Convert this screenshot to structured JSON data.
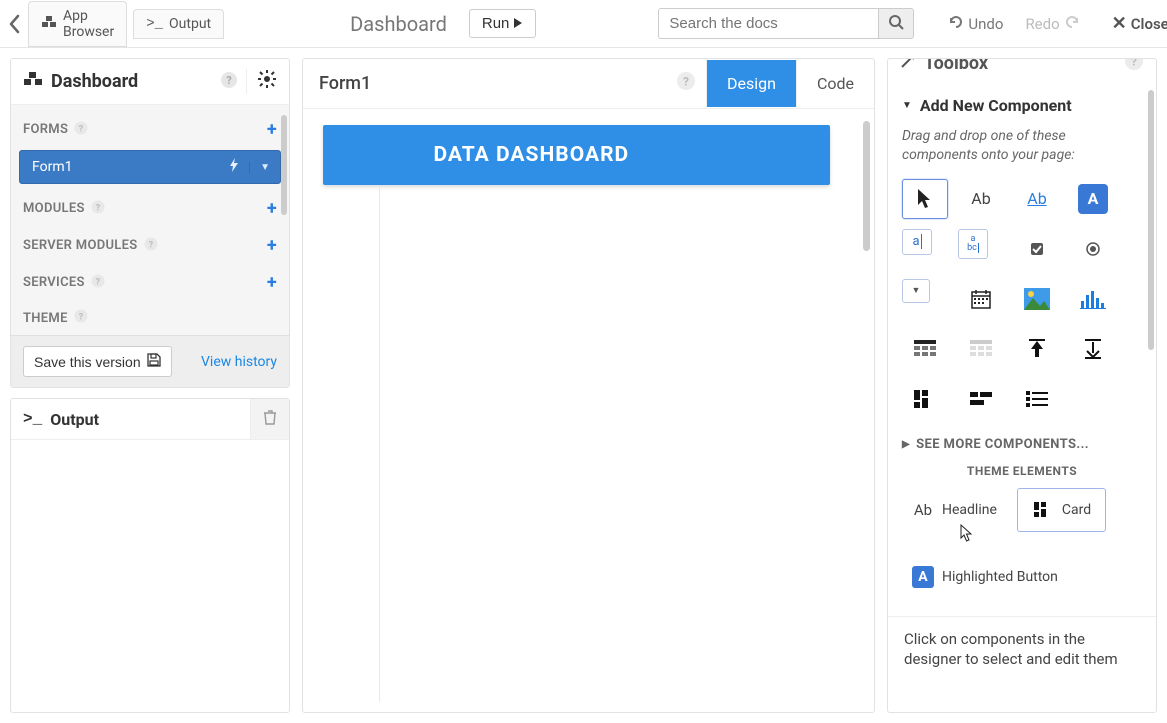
{
  "topbar": {
    "tab_browser": "App Browser",
    "tab_output": "Output",
    "title": "Dashboard",
    "run": "Run",
    "search_placeholder": "Search the docs",
    "undo": "Undo",
    "redo": "Redo",
    "close": "Close"
  },
  "left": {
    "panel_title": "Dashboard",
    "sections": {
      "forms": "FORMS",
      "modules": "MODULES",
      "server_modules": "SERVER MODULES",
      "services": "SERVICES",
      "theme": "THEME"
    },
    "form_item": "Form1",
    "save_btn": "Save this version",
    "history": "View history",
    "output_title": "Output"
  },
  "designer": {
    "form_title": "Form1",
    "tab_design": "Design",
    "tab_code": "Code",
    "banner": "DATA DASHBOARD"
  },
  "toolbox": {
    "title": "Toolbox",
    "section": "Add New Component",
    "hint": "Drag and drop one of these components onto your page:",
    "see_more": "SEE MORE COMPONENTS...",
    "theme_title": "THEME ELEMENTS",
    "theme_items": {
      "headline": "Headline",
      "card": "Card",
      "highlighted_button": "Highlighted Button"
    },
    "footer_hint": "Click on components in the designer to select and edit them",
    "palette_labels": {
      "label": "Ab",
      "link": "Ab",
      "button": "A",
      "textbox": "a",
      "textarea": "a\nbc",
      "dropdown": "▾"
    }
  }
}
